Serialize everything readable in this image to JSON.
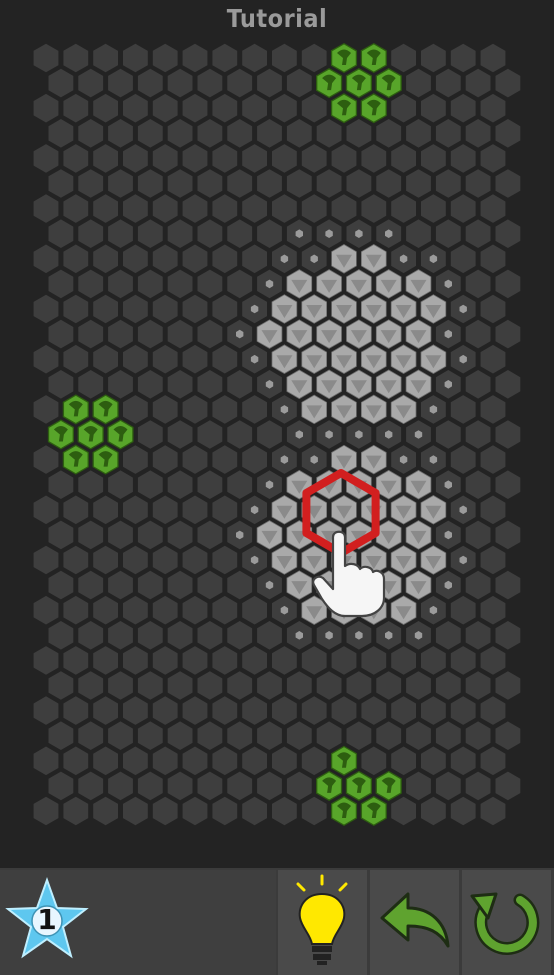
{
  "header": {
    "title": "Tutorial"
  },
  "level": {
    "number": "1"
  },
  "toolbar": {
    "hint_icon": "lightbulb-icon",
    "undo_icon": "undo-arrow-icon",
    "restart_icon": "restart-icon"
  },
  "colors": {
    "background": "#232323",
    "empty_tile": "#3e3e3e",
    "light_tile": "#a9a9a9",
    "tree_tile": "#58a52a",
    "highlight": "#d21f1f",
    "hint_bulb": "#ffe800",
    "arrow_green": "#5fa32f",
    "star_blue": "#5ec7ef"
  },
  "board": {
    "tree_clusters": 3,
    "light_clusters": 2,
    "highlighted_clusters": 1
  }
}
